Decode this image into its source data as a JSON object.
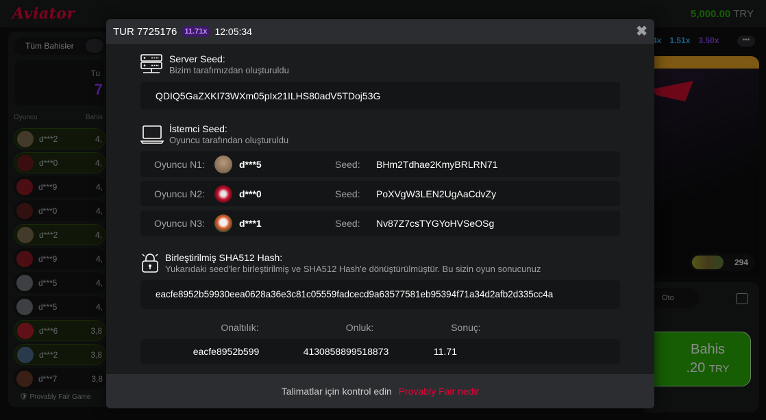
{
  "app": {
    "logo": "Aviator",
    "balance": "5,000.00",
    "currency": "TRY"
  },
  "left_panel": {
    "tab_all": "Tüm Bahisler",
    "total_label": "Tu",
    "total_value": "7",
    "col_player": "Oyuncu",
    "col_bet": "Bahis",
    "rows": [
      {
        "name": "d***2",
        "amount": "4,"
      },
      {
        "name": "d***0",
        "amount": "4,"
      },
      {
        "name": "d***9",
        "amount": "4,"
      },
      {
        "name": "d***0",
        "amount": "4,"
      },
      {
        "name": "d***2",
        "amount": "4,"
      },
      {
        "name": "d***9",
        "amount": "4,"
      },
      {
        "name": "d***5",
        "amount": "4,"
      },
      {
        "name": "d***5",
        "amount": "4,"
      },
      {
        "name": "d***6",
        "amount": "3,8"
      },
      {
        "name": "d***2",
        "amount": "3,8"
      },
      {
        "name": "d***7",
        "amount": "3,8"
      }
    ],
    "provably_fair": "Provably Fair Game"
  },
  "right_area": {
    "multipliers": [
      "4x",
      "1.51x",
      "3.50x"
    ],
    "more": "•••",
    "players_count": "294",
    "auto_label": "Oto",
    "bet_label": "Bahis",
    "bet_amount": ".20",
    "bet_currency": "TRY"
  },
  "modal": {
    "round": "TUR 7725176",
    "multiplier": "11.71x",
    "time": "12:05:34",
    "close": "✖",
    "server_seed": {
      "title": "Server Seed:",
      "subtitle": "Bizim tarafımızdan oluşturuldu",
      "value": "QDIQ5GaZXKI73WXm05pIx21ILHS80adV5TDoj53G"
    },
    "client_seed": {
      "title": "İstemci Seed:",
      "subtitle": "Oyuncu tarafından oluşturuldu",
      "seed_label": "Seed:",
      "players": [
        {
          "label": "Oyuncu N1:",
          "name": "d***5",
          "seed": "BHm2Tdhae2KmyBRLRN71"
        },
        {
          "label": "Oyuncu N2:",
          "name": "d***0",
          "seed": "PoXVgW3LEN2UgAaCdvZy"
        },
        {
          "label": "Oyuncu N3:",
          "name": "d***1",
          "seed": "Nv87Z7csTYGYoHVSeOSg"
        }
      ]
    },
    "hash": {
      "title": "Birleştirilmiş SHA512 Hash:",
      "subtitle": "Yukarıdaki seed'ler birleştirilmiş ve SHA512 Hash'e dönüştürülmüştür. Bu sizin oyun sonucunuz",
      "value": "eacfe8952b59930eea0628a36e3c81c05559fadcecd9a63577581eb95394f71a34d2afb2d335cc4a"
    },
    "result": {
      "hex_label": "Onaltılık:",
      "dec_label": "Onluk:",
      "result_label": "Sonuç:",
      "hex_value": "eacfe8952b599",
      "dec_value": "4130858899518873",
      "result_value": "11.71"
    },
    "footer": {
      "text": "Talimatlar için kontrol edin",
      "link": "Provably Fair nedir"
    }
  }
}
